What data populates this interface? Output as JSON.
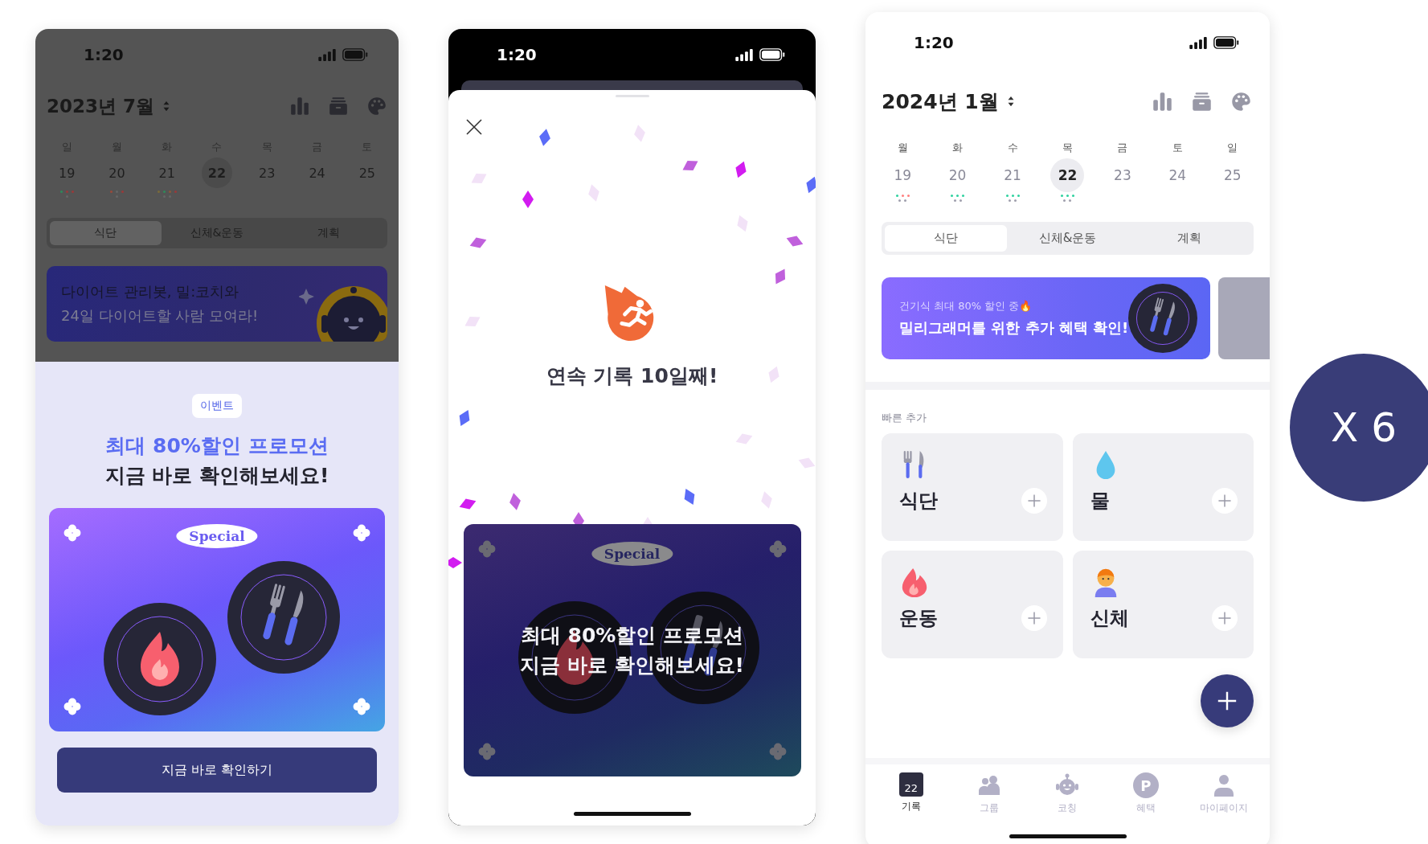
{
  "event_phone": {
    "status_time": "1:20",
    "month": "2023년 7월",
    "weekdays": [
      "일",
      "월",
      "화",
      "수",
      "목",
      "금",
      "토"
    ],
    "dates": [
      {
        "day": "19",
        "selected": false,
        "dots": [
          [
            {
              "color": "#2e8a5a"
            },
            {
              "color": "#9a3a3a"
            },
            {
              "color": "#9a3a3a"
            }
          ],
          [
            {
              "color": "#666666"
            }
          ]
        ]
      },
      {
        "day": "20",
        "selected": false,
        "dots": [
          [
            {
              "color": "#9a4a3a"
            },
            {
              "color": "#666666"
            },
            {
              "color": "#9a3a3a"
            }
          ],
          [
            {
              "color": "#666666"
            }
          ]
        ]
      },
      {
        "day": "21",
        "selected": false,
        "dots": [
          [
            {
              "color": "#7a6a3a"
            },
            {
              "color": "#2e8a5a"
            },
            {
              "color": "#8a5a3a"
            },
            {
              "color": "#9a3a3a"
            }
          ],
          [
            {
              "color": "#666666"
            },
            {
              "color": "#666666"
            }
          ]
        ]
      },
      {
        "day": "22",
        "selected": true
      },
      {
        "day": "23",
        "selected": false
      },
      {
        "day": "24",
        "selected": false
      },
      {
        "day": "25",
        "selected": false
      }
    ],
    "tabs": [
      {
        "label": "식단",
        "selected": true
      },
      {
        "label": "신체&운동",
        "selected": false
      },
      {
        "label": "계획",
        "selected": false
      }
    ],
    "banner": {
      "line1": "다이어트 관리봇, 밀:코치와",
      "line2": "24일 다이어트할 사람 모여라!"
    },
    "sheet": {
      "badge": "이벤트",
      "title": [
        "최대 80%할인 프로모션",
        "지금 바로 확인해보세요!"
      ],
      "card_label": "Special",
      "button": "지금 바로 확인하기"
    }
  },
  "streak_phone": {
    "status_time": "1:20",
    "title": "연속 기록 10일째!",
    "card": {
      "label": "Special",
      "lines": [
        "최대 80%할인 프로모션",
        "지금 바로 확인해보세요!"
      ]
    }
  },
  "home_phone": {
    "status_time": "1:20",
    "month": "2024년 1월",
    "weekdays": [
      "월",
      "화",
      "수",
      "목",
      "금",
      "토",
      "일"
    ],
    "dates": [
      {
        "day": "19",
        "selected": false,
        "dots": [
          [
            {
              "color": "#2fd3a0"
            },
            {
              "color": "#ff8080"
            },
            {
              "color": "#ff8080"
            }
          ],
          [
            {
              "color": "#a0a0ae"
            },
            {
              "color": "#a0a0ae"
            }
          ]
        ]
      },
      {
        "day": "20",
        "selected": false,
        "dots": [
          [
            {
              "color": "#2fd3a0"
            },
            {
              "color": "#2fd3a0"
            },
            {
              "color": "#2fd3a0"
            }
          ],
          [
            {
              "color": "#a0a0ae"
            },
            {
              "color": "#a0a0ae"
            }
          ]
        ]
      },
      {
        "day": "21",
        "selected": false,
        "dots": [
          [
            {
              "color": "#2fd3a0"
            },
            {
              "color": "#2fd3a0"
            },
            {
              "color": "#2fd3a0"
            }
          ],
          [
            {
              "color": "#a0a0ae"
            },
            {
              "color": "#a0a0ae"
            }
          ]
        ]
      },
      {
        "day": "22",
        "selected": true,
        "dots": [
          [
            {
              "color": "#2fd3a0"
            },
            {
              "color": "#2fd3a0"
            },
            {
              "color": "#2fd3a0"
            }
          ],
          [
            {
              "color": "#a0a0ae"
            },
            {
              "color": "#a0a0ae"
            }
          ]
        ]
      },
      {
        "day": "23",
        "selected": false
      },
      {
        "day": "24",
        "selected": false
      },
      {
        "day": "25",
        "selected": false
      }
    ],
    "tabs": [
      {
        "label": "식단",
        "selected": true
      },
      {
        "label": "신체&운동",
        "selected": false
      },
      {
        "label": "계획",
        "selected": false
      }
    ],
    "banner": {
      "subtitle": "건기식 최대 80% 할인 중🔥",
      "title": "밀리그래머를 위한 추가 혜택 확인!"
    },
    "quick_add": {
      "heading": "빠른 추가",
      "items": [
        {
          "kind": "meal",
          "label": "식단"
        },
        {
          "kind": "water",
          "label": "물"
        },
        {
          "kind": "exercise",
          "label": "운동"
        },
        {
          "kind": "body",
          "label": "신체"
        }
      ]
    },
    "nav": [
      {
        "kind": "calendar",
        "label": "기록",
        "icon_text": "22",
        "selected": true
      },
      {
        "kind": "group",
        "label": "그룹",
        "selected": false
      },
      {
        "kind": "robot",
        "label": "코칭",
        "selected": false
      },
      {
        "kind": "points",
        "label": "혜택",
        "icon_text": "P",
        "selected": false
      },
      {
        "kind": "person",
        "label": "마이페이지",
        "selected": false
      }
    ]
  },
  "multiplier_badge": "X 6"
}
